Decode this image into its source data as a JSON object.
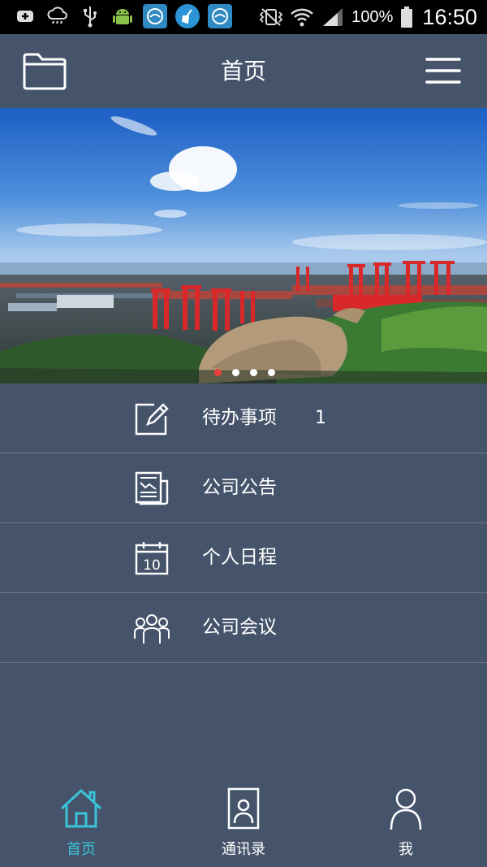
{
  "status_bar": {
    "battery_percent": "100%",
    "time": "16:50",
    "icons": [
      "add-box-icon",
      "cloud-drizzle-icon",
      "usb-icon",
      "android-icon",
      "app-notification-icon",
      "broom-icon",
      "app-notification-icon",
      "vibrate-icon",
      "wifi-icon",
      "signal-icon",
      "battery-icon"
    ]
  },
  "header": {
    "title": "首页",
    "left_icon": "folder-icon",
    "right_icon": "menu-icon"
  },
  "banner": {
    "slides_count": 4,
    "active_index": 0,
    "colors": {
      "active_dot": "#e8403c",
      "dot": "#ffffff"
    }
  },
  "menu": {
    "items": [
      {
        "label": "待办事项",
        "badge": "1",
        "icon": "edit-note-icon"
      },
      {
        "label": "公司公告",
        "badge": "",
        "icon": "newspaper-icon"
      },
      {
        "label": "个人日程",
        "badge": "",
        "icon": "calendar-icon",
        "icon_text": "10"
      },
      {
        "label": "公司会议",
        "badge": "",
        "icon": "group-icon"
      }
    ]
  },
  "bottom_nav": {
    "items": [
      {
        "label": "首页",
        "icon": "home-icon",
        "active": true
      },
      {
        "label": "通讯录",
        "icon": "contact-card-icon",
        "active": false
      },
      {
        "label": "我",
        "icon": "person-icon",
        "active": false
      }
    ]
  },
  "theme": {
    "background": "#46546b",
    "divider": "#6b7890",
    "accent": "#3bc3d8",
    "status_bar": "#000000"
  }
}
